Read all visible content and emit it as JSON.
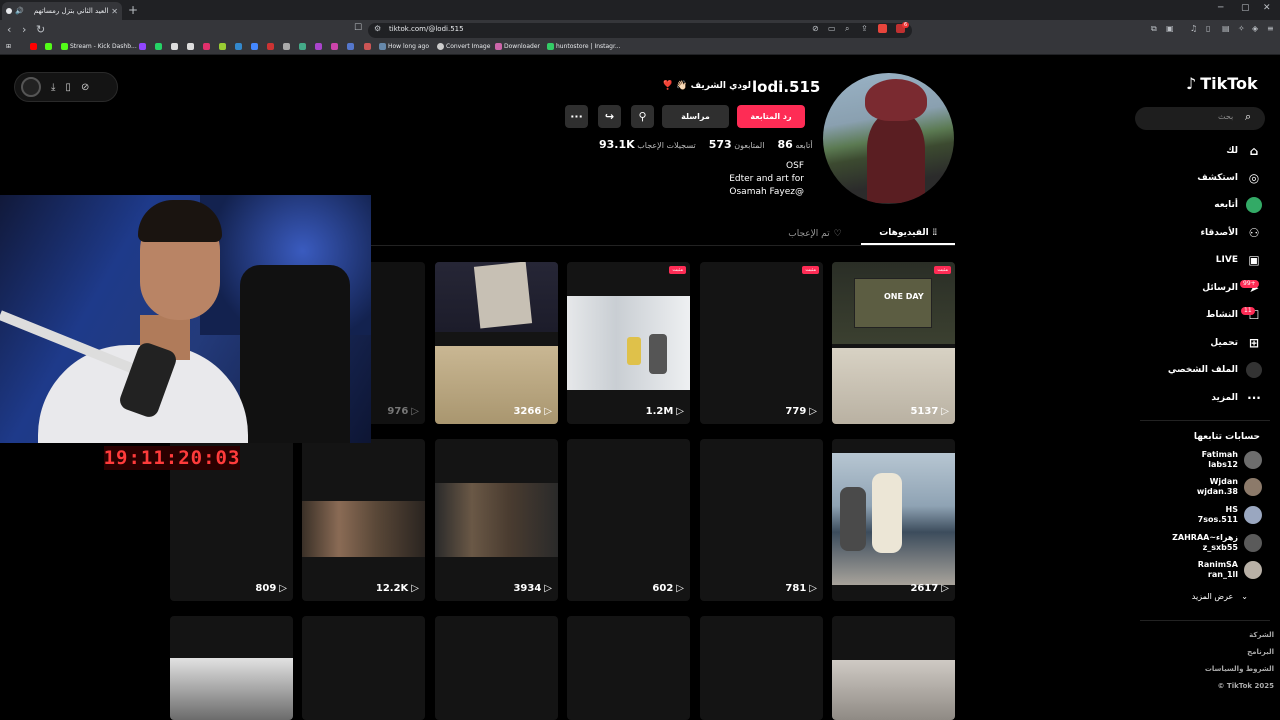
{
  "browser": {
    "tab_title": "العيد الثاني بتزل رمساتهم",
    "url": "tiktok.com/@lodi.515",
    "bookmarks": [
      "Stream - Kick Dashb...",
      "How long ago",
      "Convert Image",
      "Downloader",
      "huntostore | Instagr..."
    ],
    "extension_badge": "6"
  },
  "tiktok": {
    "logo": "TikTok",
    "search_placeholder": "بحث",
    "nav": [
      {
        "label": "لك",
        "icon": "home-icon"
      },
      {
        "label": "استكشف",
        "icon": "compass-icon"
      },
      {
        "label": "أتابعه",
        "icon": "following-avatar-icon"
      },
      {
        "label": "الأصدقاء",
        "icon": "friends-icon"
      },
      {
        "label": "LIVE",
        "icon": "live-icon"
      },
      {
        "label": "الرسائل",
        "icon": "messages-icon",
        "badge": "99+"
      },
      {
        "label": "النشاط",
        "icon": "activity-icon",
        "badge": "11"
      },
      {
        "label": "تحميل",
        "icon": "upload-icon"
      },
      {
        "label": "الملف الشخصي",
        "icon": "profile-icon"
      },
      {
        "label": "المزيد",
        "icon": "more-icon"
      }
    ],
    "following_title": "حسابات تتابعها",
    "following": [
      {
        "name": "Fatimah",
        "handle": "labs12"
      },
      {
        "name": "Wjdan",
        "handle": "wjdan.38"
      },
      {
        "name": "HS",
        "handle": "7sos.511"
      },
      {
        "name": "ZAHRAA~زهراء",
        "handle": "z_sxb55"
      },
      {
        "name": "RanimSA",
        "handle": "ran_1ll"
      }
    ],
    "see_more": "عرض المزيد",
    "footer": [
      "الشركة",
      "البرنامج",
      "الشروط والسياسات",
      "© TikTok 2025"
    ]
  },
  "profile": {
    "username": "lodi.515",
    "nickname": "لودي الشريف 👋🏻 ❣️",
    "follow_back": "رد المتابعة",
    "message": "مراسلة",
    "stats": [
      {
        "value": "86",
        "label": "أتابعه"
      },
      {
        "value": "573",
        "label": "المتابعون"
      },
      {
        "value": "93.1K",
        "label": "تسجيلات الإعجاب"
      }
    ],
    "bio": [
      "OSF",
      "Edter and art for",
      "Osamah Fayez@"
    ],
    "tab_videos": "الفيديوهات",
    "tab_liked": "تم الإعجاب",
    "pinned_label": "مثبت",
    "videos": [
      {
        "views": "5137",
        "pinned": true
      },
      {
        "views": "779",
        "pinned": true
      },
      {
        "views": "1.2M",
        "pinned": true
      },
      {
        "views": "3266",
        "pinned": false
      },
      {
        "views": "976",
        "pinned": false
      },
      {
        "views": "2617",
        "pinned": false
      },
      {
        "views": "781",
        "pinned": false
      },
      {
        "views": "602",
        "pinned": false
      },
      {
        "views": "3934",
        "pinned": false
      },
      {
        "views": "12.2K",
        "pinned": false
      },
      {
        "views": "809",
        "pinned": false
      }
    ],
    "thumb_texts": {
      "one_day": "ONE DAY"
    }
  },
  "stream_overlay": {
    "timer": "19:11:20:03"
  }
}
